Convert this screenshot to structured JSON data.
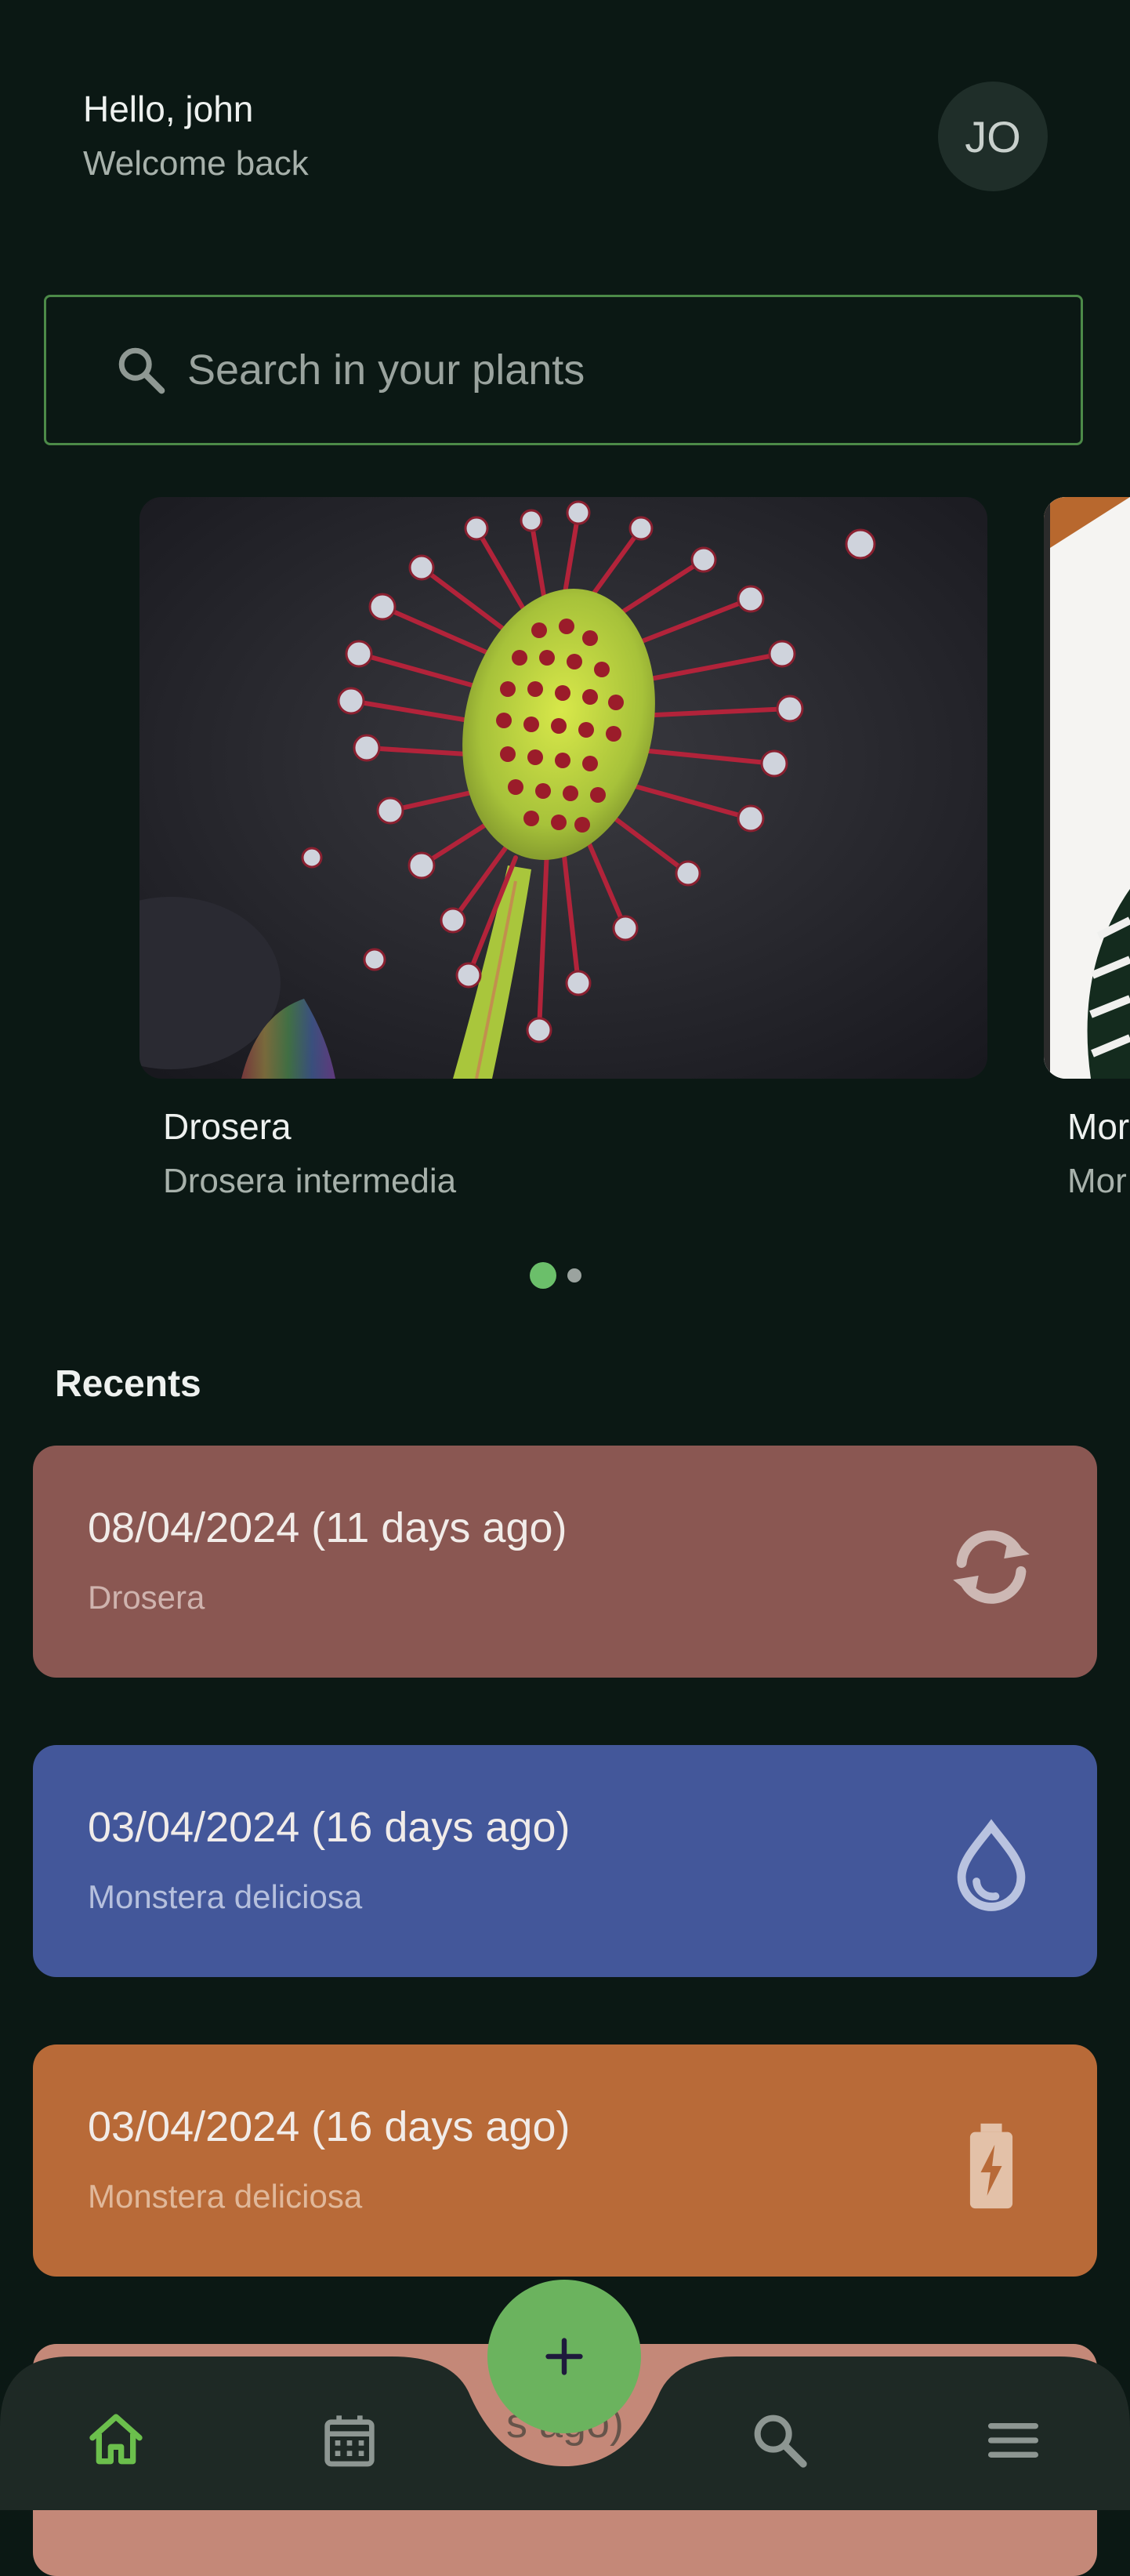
{
  "header": {
    "greeting": "Hello, john",
    "subtitle": "Welcome back",
    "avatar_initials": "JO"
  },
  "search": {
    "placeholder": "Search in your plants",
    "icon": "search-icon"
  },
  "carousel": {
    "plants": [
      {
        "name": "Drosera",
        "latin": "Drosera intermedia"
      },
      {
        "name": "Mor",
        "latin": "Mor"
      }
    ],
    "page_count": 2,
    "active_page": 0
  },
  "recents": {
    "title": "Recents",
    "items": [
      {
        "date": "08/04/2024 (11 days ago)",
        "plant": "Drosera",
        "icon": "repot-icon",
        "color": "#8a5752"
      },
      {
        "date": "03/04/2024 (16 days ago)",
        "plant": "Monstera deliciosa",
        "icon": "water-drop-icon",
        "color": "#43579a"
      },
      {
        "date": "03/04/2024 (16 days ago)",
        "plant": "Monstera deliciosa",
        "icon": "fertilize-battery-icon",
        "color": "#b86a38"
      },
      {
        "date": "s ago)",
        "plant": "",
        "icon": "",
        "color": "#c48878"
      }
    ]
  },
  "bottom_nav": {
    "items": [
      "home-icon",
      "calendar-icon",
      "search-icon",
      "menu-icon"
    ],
    "active": "home-icon",
    "fab_icon": "add-icon"
  },
  "colors": {
    "background": "#0b1814",
    "accent": "#6bb35e",
    "nav_background": "#1e2925"
  }
}
